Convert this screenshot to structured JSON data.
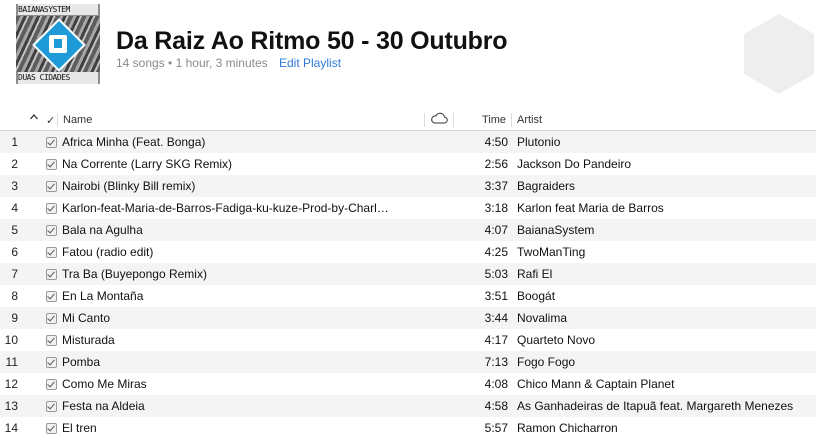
{
  "artwork": {
    "top_text": "BAIANASYSTEM",
    "bottom_text": "DUAS CIDADES"
  },
  "playlist": {
    "title": "Da Raiz Ao Ritmo 50 - 30 Outubro",
    "song_count": "14 songs",
    "separator": "•",
    "duration": "1 hour, 3 minutes",
    "edit_label": "Edit Playlist"
  },
  "columns": {
    "sort_icon": "chevron-up-icon",
    "check_label": "✓",
    "name": "Name",
    "cloud_icon": "cloud-icon",
    "time": "Time",
    "artist": "Artist"
  },
  "tracks": [
    {
      "num": "1",
      "name": "Africa Minha (Feat. Bonga)",
      "time": "4:50",
      "artist": "Plutonio"
    },
    {
      "num": "2",
      "name": "Na Corrente (Larry SKG Remix)",
      "time": "2:56",
      "artist": "Jackson Do Pandeiro"
    },
    {
      "num": "3",
      "name": "Nairobi (Blinky Bill remix)",
      "time": "3:37",
      "artist": "Bagraiders"
    },
    {
      "num": "4",
      "name": "Karlon-feat-Maria-de-Barros-Fadiga-ku-kuze-Prod-by-Charl…",
      "time": "3:18",
      "artist": "Karlon feat Maria de Barros"
    },
    {
      "num": "5",
      "name": "Bala na Agulha",
      "time": "4:07",
      "artist": "BaianaSystem"
    },
    {
      "num": "6",
      "name": "Fatou (radio edit)",
      "time": "4:25",
      "artist": "TwoManTing"
    },
    {
      "num": "7",
      "name": "Tra Ba (Buyepongo Remix)",
      "time": "5:03",
      "artist": "Rafi El"
    },
    {
      "num": "8",
      "name": "En La Montaña",
      "time": "3:51",
      "artist": "Boogát"
    },
    {
      "num": "9",
      "name": "Mi Canto",
      "time": "3:44",
      "artist": "Novalima"
    },
    {
      "num": "10",
      "name": "Misturada",
      "time": "4:17",
      "artist": "Quarteto Novo"
    },
    {
      "num": "11",
      "name": "Pomba",
      "time": "7:13",
      "artist": "Fogo Fogo"
    },
    {
      "num": "12",
      "name": "Como Me Miras",
      "time": "4:08",
      "artist": "Chico Mann & Captain Planet"
    },
    {
      "num": "13",
      "name": "Festa na Aldeia",
      "time": "4:58",
      "artist": "As Ganhadeiras de Itapuã feat. Margareth Menezes"
    },
    {
      "num": "14",
      "name": "El tren",
      "time": "5:57",
      "artist": "Ramon Chicharron"
    }
  ]
}
